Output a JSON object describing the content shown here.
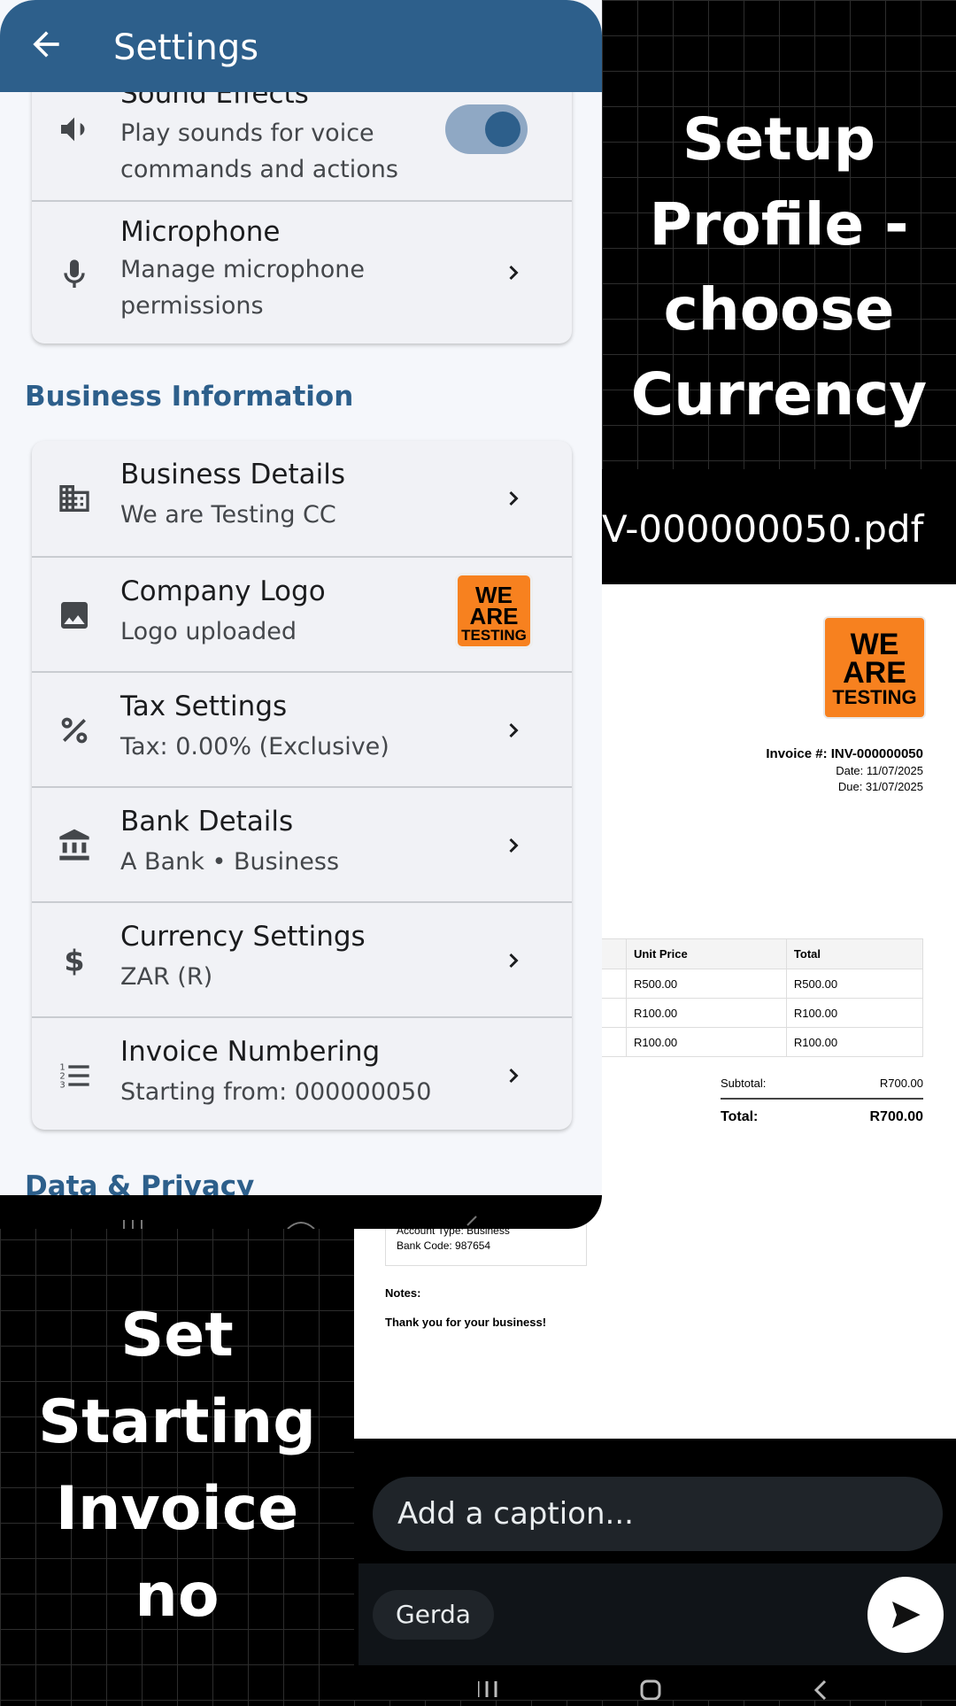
{
  "overlay": {
    "right_title": "Setup Profile - choose Currency",
    "left_title": "Set Starting Invoice no"
  },
  "settings": {
    "app_bar_title": "Settings",
    "sound_effects": {
      "title": "Sound Effects",
      "subtitle_1": "Play sounds for voice",
      "subtitle_2": "commands and actions",
      "toggle_on": true
    },
    "microphone": {
      "title": "Microphone",
      "subtitle_1": "Manage microphone",
      "subtitle_2": "permissions"
    },
    "section_business": "Business Information",
    "business_details": {
      "title": "Business Details",
      "subtitle": "We are Testing CC"
    },
    "company_logo": {
      "title": "Company Logo",
      "subtitle": "Logo uploaded"
    },
    "tax": {
      "title": "Tax Settings",
      "subtitle": "Tax: 0.00% (Exclusive)"
    },
    "bank": {
      "title": "Bank Details",
      "subtitle": "A Bank • Business"
    },
    "currency": {
      "title": "Currency Settings",
      "subtitle": "ZAR (R)"
    },
    "invoice_numbering": {
      "title": "Invoice Numbering",
      "subtitle": "Starting from: 000000050"
    },
    "section_data": "Data & Privacy"
  },
  "logo": {
    "line1": "WE",
    "line2": "ARE",
    "line3": "TESTING",
    "color": "#f7811f"
  },
  "document": {
    "file_name": "V-000000050.pdf",
    "invoice_number_label": "Invoice #: INV-000000050",
    "date": "Date: 11/07/2025",
    "due": "Due: 31/07/2025",
    "columns": [
      "Unit Price",
      "Total"
    ],
    "rows": [
      [
        "R500.00",
        "R500.00"
      ],
      [
        "R100.00",
        "R100.00"
      ],
      [
        "R100.00",
        "R100.00"
      ]
    ],
    "subtotal_label": "Subtotal:",
    "subtotal_value": "R700.00",
    "total_label": "Total:",
    "total_value": "R700.00",
    "bank_account_type": "Account Type: Business",
    "bank_code": "Bank Code: 987654",
    "notes_label": "Notes:",
    "notes_text": "Thank you for your business!"
  },
  "whatsapp": {
    "caption_placeholder": "Add a caption...",
    "recipient": "Gerda"
  },
  "colors": {
    "primary": "#2d5f8b",
    "accent_orange": "#f7811f"
  }
}
